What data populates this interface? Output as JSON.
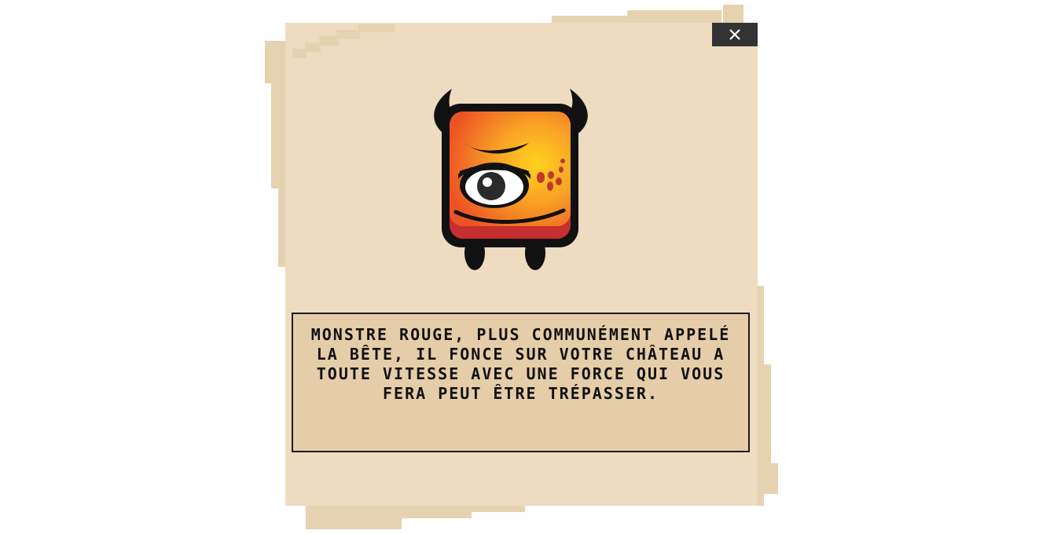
{
  "dialog": {
    "close_icon": "close-icon",
    "monster_icon": "red-monster-icon",
    "description": "Monstre rouge, plus communément appelé la bête, il fonce sur votre château a toute vitesse avec une force qui vous fera peut être trépasser."
  },
  "colors": {
    "parchment": "#eddcc0",
    "parchment_shadow": "#e6d2b0",
    "text_box": "#e4cda8",
    "close_button": "#333333",
    "text": "#111111"
  }
}
